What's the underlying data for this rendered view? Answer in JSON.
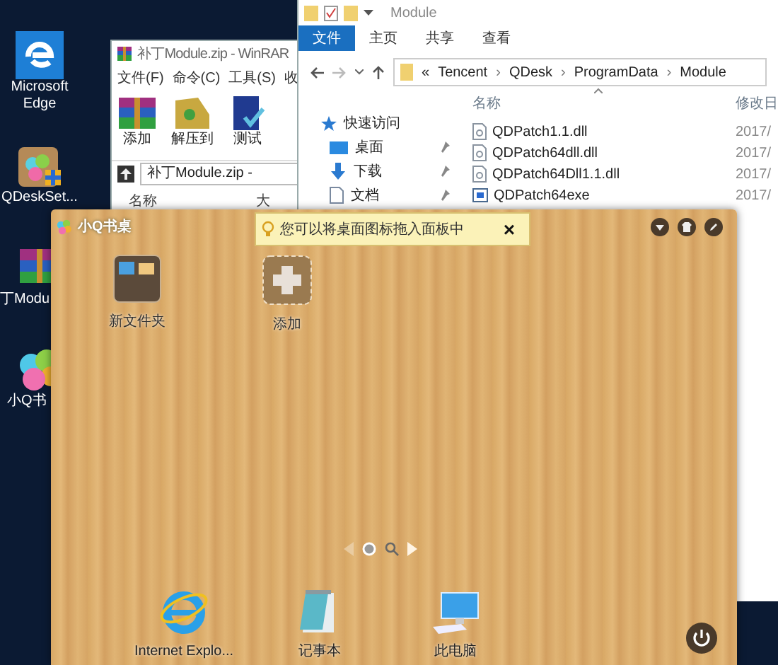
{
  "desktop_icons": [
    {
      "label": "Microsoft Edge",
      "kind": "edge"
    },
    {
      "label": "QDeskSet...",
      "kind": "setup"
    },
    {
      "label": "丁Modu",
      "kind": "rar"
    },
    {
      "label": "小Q书",
      "kind": "flower"
    }
  ],
  "winrar": {
    "title": "补丁Module.zip - WinRAR",
    "menu": [
      "文件(F)",
      "命令(C)",
      "工具(S)",
      "收"
    ],
    "toolbar": [
      {
        "label": "添加",
        "kind": "add"
      },
      {
        "label": "解压到",
        "kind": "extract"
      },
      {
        "label": "测试",
        "kind": "test"
      }
    ],
    "path": "补丁Module.zip - ",
    "columns": [
      "名称",
      "大"
    ]
  },
  "explorer": {
    "title": "Module",
    "tabs": [
      {
        "label": "文件",
        "selected": true
      },
      {
        "label": "主页",
        "selected": false
      },
      {
        "label": "共享",
        "selected": false
      },
      {
        "label": "查看",
        "selected": false
      }
    ],
    "breadcrumb_prefix": "«",
    "separator": "›",
    "breadcrumb": [
      "Tencent",
      "QDesk",
      "ProgramData",
      "Module"
    ],
    "nav": [
      {
        "label": "快速访问",
        "kind": "star",
        "pinned": false
      },
      {
        "label": "桌面",
        "kind": "desktop",
        "pinned": true
      },
      {
        "label": "下载",
        "kind": "download",
        "pinned": true
      },
      {
        "label": "文档",
        "kind": "doc",
        "pinned": true
      }
    ],
    "columns": [
      "名称",
      "修改日"
    ],
    "files": [
      {
        "name": "QDPatch1.1.dll",
        "date": "2017/",
        "kind": "dll"
      },
      {
        "name": "QDPatch64dll.dll",
        "date": "2017/",
        "kind": "dll"
      },
      {
        "name": "QDPatch64Dll1.1.dll",
        "date": "2017/",
        "kind": "dll"
      },
      {
        "name": "QDPatch64exe",
        "date": "2017/",
        "kind": "exe"
      }
    ]
  },
  "qdesk": {
    "title": "小Q书桌",
    "tip": "您可以将桌面图标拖入面板中",
    "tip_close": "×",
    "items": [
      {
        "label": "新文件夹",
        "kind": "folder"
      },
      {
        "label": "添加",
        "kind": "add"
      }
    ],
    "pages": [
      {
        "selected": true
      }
    ],
    "dock": [
      {
        "label": "Internet Explo...",
        "kind": "ie"
      },
      {
        "label": "记事本",
        "kind": "notepad"
      },
      {
        "label": "此电脑",
        "kind": "pc"
      }
    ]
  }
}
